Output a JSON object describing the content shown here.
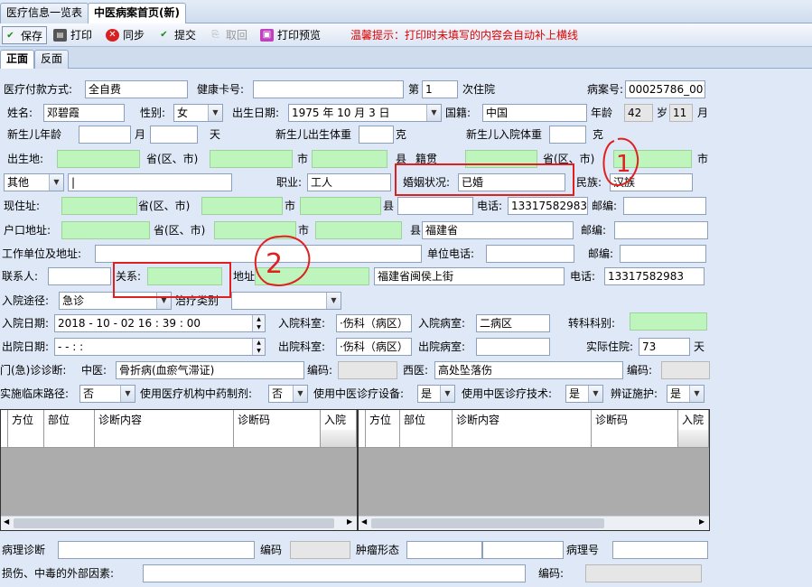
{
  "tabs": {
    "tab1": "医疗信息一览表",
    "tab2": "中医病案首页(新)"
  },
  "toolbar": {
    "save": "保存",
    "print": "打印",
    "sync": "同步",
    "submit": "提交",
    "retract": "取回",
    "preview": "打印预览",
    "tip": "温馨提示：打印时未填写的内容会自动补上横线"
  },
  "subtabs": {
    "front": "正面",
    "back": "反面"
  },
  "row1": {
    "payment_label": "医疗付款方式:",
    "payment": "全自费",
    "card_label": "健康卡号:",
    "card": "",
    "times_label": "第",
    "times": "1",
    "times_unit": "次住院",
    "record_label": "病案号:",
    "record_no": "00025786_001"
  },
  "row2": {
    "name_label": "姓名:",
    "name": "邓碧霞",
    "sex_label": "性别:",
    "sex": "女",
    "birth_label": "出生日期:",
    "birth": "1975 年 10 月 3 日",
    "nation_label": "国籍:",
    "nation": "中国",
    "age_label": "年龄",
    "age": "42",
    "age_unit": "岁",
    "month": "11",
    "month_unit": "月"
  },
  "row3": {
    "newborn_age": "新生儿年龄",
    "month_unit": "月",
    "day_unit": "天",
    "birth_weight": "新生儿出生体重",
    "g1": "克",
    "admit_weight": "新生儿入院体重",
    "g2": "克"
  },
  "row4": {
    "birthplace": "出生地:",
    "prov": "省(区、市)",
    "city": "市",
    "county": "县",
    "origin": "籍贯",
    "prov2": "省(区、市)",
    "city2": "市"
  },
  "row5": {
    "idtype": "其他",
    "job_label": "职业:",
    "job": "工人",
    "marital_label": "婚姻状况:",
    "marital": "已婚",
    "ethnic_label": "民族:",
    "ethnic": "汉族"
  },
  "row6": {
    "addr_label": "现住址:",
    "prov": "省(区、市)",
    "city": "市",
    "county": "县",
    "phone_label": "电话:",
    "phone": "13317582983",
    "zip_label": "邮编:"
  },
  "row7": {
    "hukou_label": "户口地址:",
    "prov": "省(区、市)",
    "city": "市",
    "county": "县",
    "county_val": "福建省",
    "zip_label": "邮编:"
  },
  "row8": {
    "work_label": "工作单位及地址:",
    "work_phone_label": "单位电话:",
    "zip_label": "邮编:"
  },
  "row9": {
    "contact_label": "联系人:",
    "relation_label": "关系:",
    "addr_label": "地址",
    "addr": "福建省闽侯上街",
    "phone_label": "电话:",
    "phone": "13317582983"
  },
  "row10": {
    "route_label": "入院途径:",
    "route": "急诊",
    "therapy_label": "治疗类别"
  },
  "row11": {
    "admit_date_label": "入院日期:",
    "admit_date": "2018 - 10 - 02   16 : 39 : 00",
    "dept_label": "入院科室:",
    "dept": "·伤科（病区）",
    "ward_label": "入院病室:",
    "ward": "二病区",
    "transfer_label": "转科科别:"
  },
  "row12": {
    "out_date_label": "出院日期:",
    "out_date": "  -    -        :    :",
    "dept_label": "出院科室:",
    "dept": "·伤科（病区）",
    "ward_label": "出院病室:",
    "days_label": "实际住院:",
    "days": "73",
    "days_unit": "天"
  },
  "row13": {
    "diag_label": "门(急)诊诊断:",
    "tcm_label": "中医:",
    "tcm": "骨折病(血瘀气滞证)",
    "code_label": "编码:",
    "west_label": "西医:",
    "west": "高处坠落伤",
    "code2_label": "编码:"
  },
  "row14": {
    "path_label": "实施临床路径:",
    "path": "否",
    "prep_label": "使用医疗机构中药制剂:",
    "prep": "否",
    "equip_label": "使用中医诊疗设备:",
    "equip": "是",
    "tech_label": "使用中医诊疗技术:",
    "tech": "是",
    "syndrome_label": "辨证施护:",
    "syndrome": "是"
  },
  "grid_left": {
    "cols": [
      "方位",
      "部位",
      "诊断内容",
      "诊断码",
      "入院病"
    ]
  },
  "grid_right": {
    "cols": [
      "方位",
      "部位",
      "诊断内容",
      "诊断码",
      "入院"
    ]
  },
  "row15": {
    "path_diag_label": "病理诊断",
    "code_label": "编码",
    "tumor_label": "肿瘤形态",
    "path_no_label": "病理号"
  },
  "row16": {
    "injury_label": "损伤、中毒的外部因素:",
    "code_label": "编码:"
  },
  "annotations": {
    "mark1": "1",
    "mark2": "2"
  }
}
